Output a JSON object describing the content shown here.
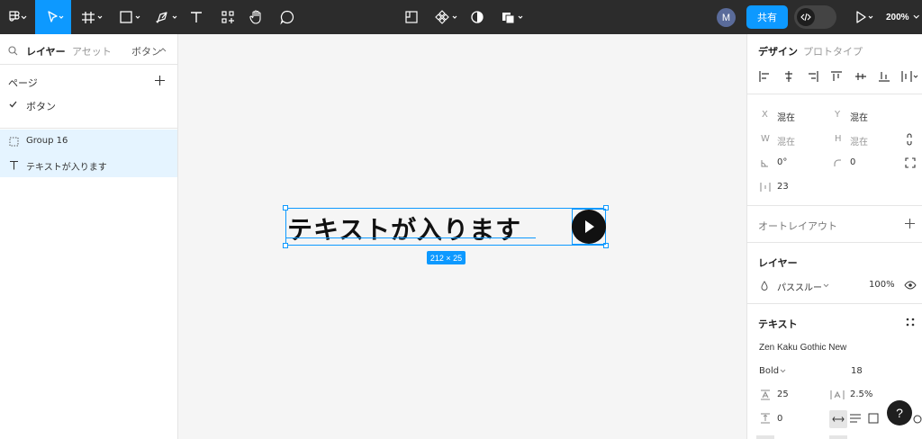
{
  "toolbar": {
    "share_label": "共有",
    "avatar_initial": "M",
    "zoom": "200%"
  },
  "left_panel": {
    "tabs": {
      "layers": "レイヤー",
      "assets": "アセット",
      "page_select": "ボタン"
    },
    "pages_title": "ページ",
    "pages": [
      {
        "label": "ボタン",
        "selected": true
      }
    ],
    "layers": [
      {
        "label": "Group 16",
        "icon": "group-dashed-icon"
      },
      {
        "label": "テキストが入ります",
        "icon": "text-t-icon"
      }
    ]
  },
  "canvas": {
    "button_text": "テキストが入ります",
    "size_badge": "212 × 25"
  },
  "right_panel": {
    "tabs": {
      "design": "デザイン",
      "prototype": "プロトタイプ"
    },
    "x_label": "X",
    "x_value": "混在",
    "y_label": "Y",
    "y_value": "混在",
    "w_label": "W",
    "w_value": "混在",
    "h_label": "H",
    "h_value": "混在",
    "rotation": "0°",
    "radius": "0",
    "spacing": "23",
    "auto_layout": "オートレイアウト",
    "layer_title": "レイヤー",
    "blend_mode": "パススルー",
    "opacity": "100%",
    "text_title": "テキスト",
    "font_family": "Zen Kaku Gothic New",
    "font_weight": "Bold",
    "font_size": "18",
    "line_height": "25",
    "letter_spacing": "2.5%",
    "paragraph_spacing": "0",
    "help": "?"
  }
}
